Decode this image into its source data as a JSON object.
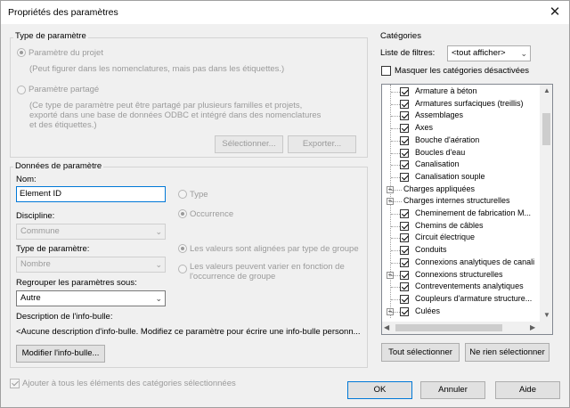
{
  "title": "Propriétés des paramètres",
  "param_type": {
    "group_title": "Type de paramètre",
    "project_label": "Paramètre du projet",
    "project_desc": "(Peut figurer dans les nomenclatures, mais pas dans les étiquettes.)",
    "shared_label": "Paramètre partagé",
    "shared_desc_1": "(Ce type de paramètre peut être partagé par plusieurs familles et projets,",
    "shared_desc_2": "exporté dans une base de données ODBC et intégré dans des nomenclatures",
    "shared_desc_3": "et des étiquettes.)",
    "select_button": "Sélectionner...",
    "export_button": "Exporter..."
  },
  "param_data": {
    "group_title": "Données de paramètre",
    "name_label": "Nom:",
    "name_value": "Element ID",
    "type_radio": "Type",
    "occurrence_radio": "Occurrence",
    "discipline_label": "Discipline:",
    "discipline_value": "Commune",
    "param_type_label": "Type de paramètre:",
    "param_type_value": "Nombre",
    "aligned_radio": "Les valeurs sont alignées par type de groupe",
    "vary_radio_1": "Les valeurs peuvent varier en fonction de",
    "vary_radio_2": "l'occurrence de groupe",
    "group_under_label": "Regrouper les paramètres sous:",
    "group_under_value": "Autre",
    "tooltip_label": "Description de l'info-bulle:",
    "tooltip_value": "<Aucune description d'info-bulle. Modifiez ce paramètre pour écrire une info-bulle personn...",
    "edit_tooltip_button": "Modifier l'info-bulle..."
  },
  "categories": {
    "title": "Catégories",
    "filter_label": "Liste de filtres:",
    "filter_value": "<tout afficher>",
    "hide_unchecked_label": "Masquer les catégories désactivées",
    "items": [
      {
        "label": "Armature à béton",
        "kind": "check"
      },
      {
        "label": "Armatures surfaciques (treillis)",
        "kind": "check"
      },
      {
        "label": "Assemblages",
        "kind": "check"
      },
      {
        "label": "Axes",
        "kind": "check"
      },
      {
        "label": "Bouche d'aération",
        "kind": "check"
      },
      {
        "label": "Boucles d'eau",
        "kind": "check"
      },
      {
        "label": "Canalisation",
        "kind": "check"
      },
      {
        "label": "Canalisation souple",
        "kind": "check"
      },
      {
        "label": "Charges appliquées",
        "kind": "group"
      },
      {
        "label": "Charges internes structurelles",
        "kind": "group"
      },
      {
        "label": "Cheminement de fabrication M...",
        "kind": "check"
      },
      {
        "label": "Chemins de câbles",
        "kind": "check"
      },
      {
        "label": "Circuit électrique",
        "kind": "check"
      },
      {
        "label": "Conduits",
        "kind": "check"
      },
      {
        "label": "Connexions analytiques de canali",
        "kind": "check"
      },
      {
        "label": "Connexions structurelles",
        "kind": "expand-check"
      },
      {
        "label": "Contreventements analytiques",
        "kind": "check"
      },
      {
        "label": "Coupleurs d'armature structure...",
        "kind": "check"
      },
      {
        "label": "Culées",
        "kind": "expand-check"
      }
    ],
    "select_all_button": "Tout sélectionner",
    "select_none_button": "Ne rien sélectionner"
  },
  "footer": {
    "add_all_label": "Ajouter à tous les éléments des catégories sélectionnées",
    "ok_button": "OK",
    "cancel_button": "Annuler",
    "help_button": "Aide"
  },
  "icons": {
    "close": "close-icon",
    "dropdown": "chevron-down-icon"
  }
}
